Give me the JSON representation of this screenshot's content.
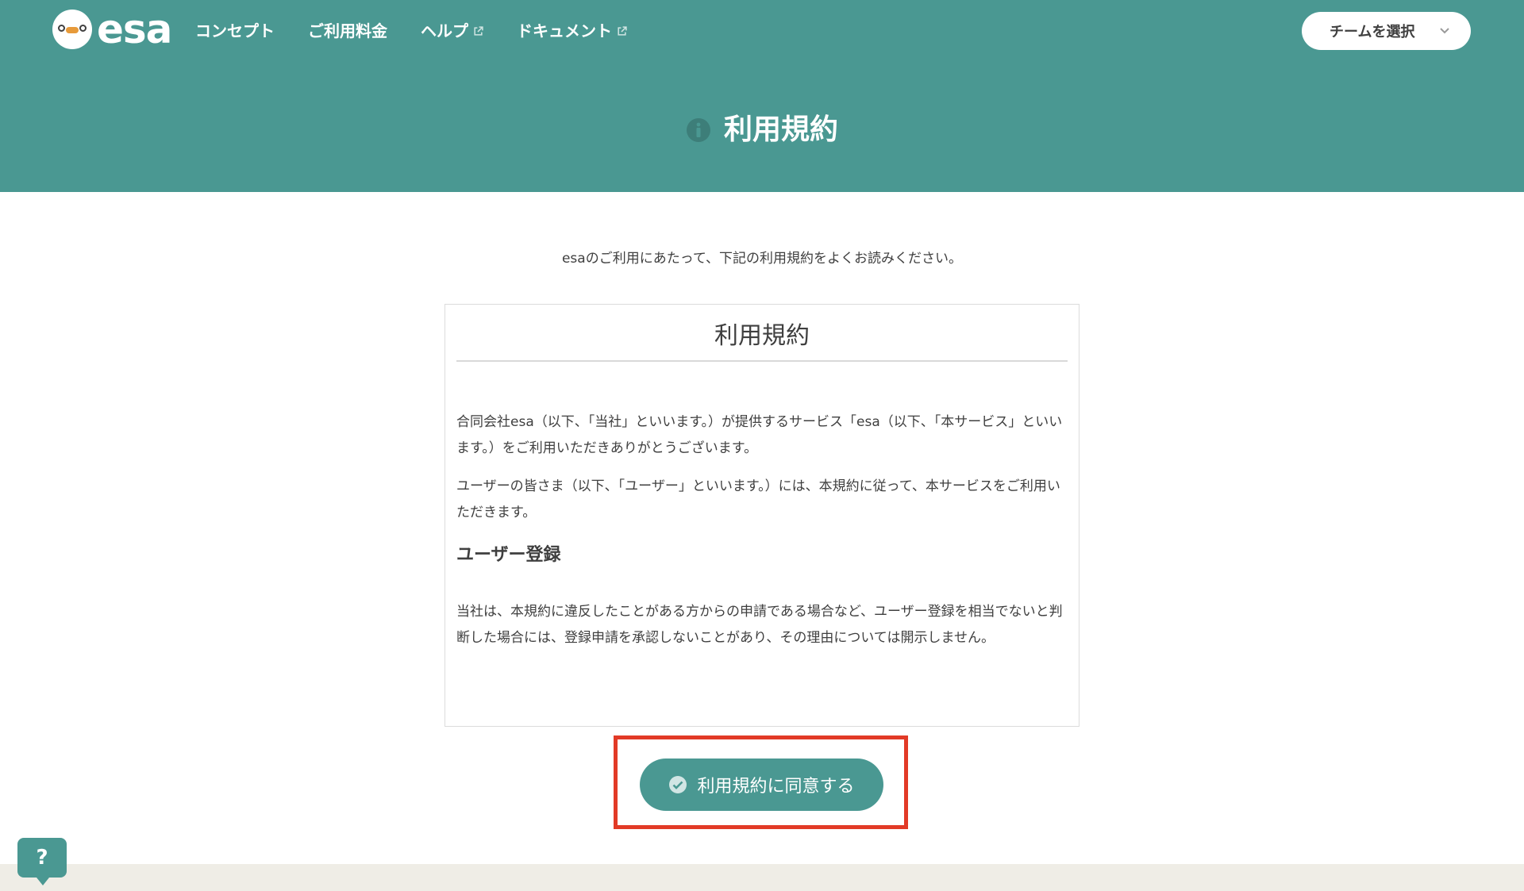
{
  "nav": {
    "logo_text": "esa",
    "links": [
      {
        "label": "コンセプト",
        "external": false
      },
      {
        "label": "ご利用料金",
        "external": false
      },
      {
        "label": "ヘルプ",
        "external": true
      },
      {
        "label": "ドキュメント",
        "external": true
      }
    ],
    "team_select": {
      "label": "チームを選択"
    }
  },
  "header": {
    "title": "利用規約"
  },
  "main": {
    "intro": "esaのご利用にあたって、下記の利用規約をよくお読みください。",
    "terms": {
      "title": "利用規約",
      "paragraph_1": "合同会社esa（以下、「当社」といいます。）が提供するサービス「esa（以下、「本サービス」といいます。）をご利用いただきありがとうございます。",
      "paragraph_2": "ユーザーの皆さま（以下、「ユーザー」といいます。）には、本規約に従って、本サービスをご利用いただきます。",
      "section_heading": "ユーザー登録",
      "paragraph_3": "当社は、本規約に違反したことがある方からの申請である場合など、ユーザー登録を相当でないと判断した場合には、登録申請を承認しないことがあり、その理由については開示しません。"
    },
    "agree_button": "利用規約に同意する"
  },
  "help_button": "?",
  "colors": {
    "brand": "#4a9892",
    "highlight": "#e23a26",
    "footer_bg": "#efede6"
  }
}
